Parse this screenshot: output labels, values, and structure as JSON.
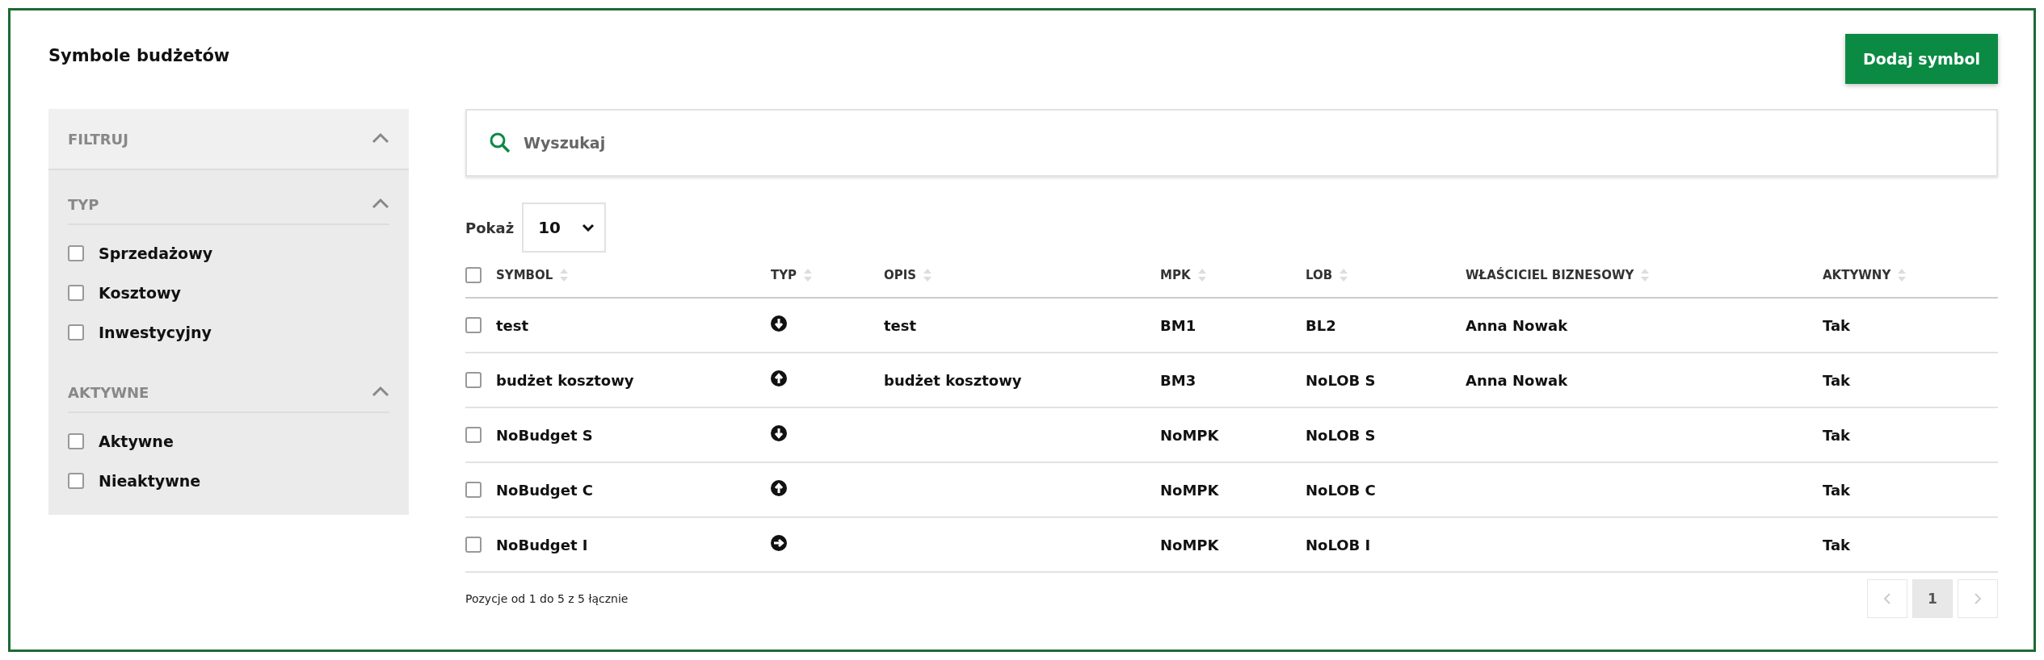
{
  "title": "Symbole budżetów",
  "add_button": "Dodaj symbol",
  "filter": {
    "title": "FILTRUJ",
    "expanded": true,
    "groups": [
      {
        "title": "TYP",
        "expanded": true,
        "options": [
          {
            "label": "Sprzedażowy",
            "checked": false
          },
          {
            "label": "Kosztowy",
            "checked": false
          },
          {
            "label": "Inwestycyjny",
            "checked": false
          }
        ]
      },
      {
        "title": "AKTYWNE",
        "expanded": true,
        "options": [
          {
            "label": "Aktywne",
            "checked": false
          },
          {
            "label": "Nieaktywne",
            "checked": false
          }
        ]
      }
    ]
  },
  "search": {
    "placeholder": "Wyszukaj"
  },
  "page_size": {
    "label": "Pokaż",
    "value": "10"
  },
  "table": {
    "select_all": false,
    "columns": [
      "SYMBOL",
      "TYP",
      "OPIS",
      "MPK",
      "LOB",
      "WŁAŚCICIEL BIZNESOWY",
      "AKTYWNY"
    ],
    "rows": [
      {
        "checked": false,
        "symbol": "test",
        "kind": "down",
        "opis": "test",
        "mpk": "BM1",
        "lob": "BL2",
        "owner": "Anna Nowak",
        "active": "Tak"
      },
      {
        "checked": false,
        "symbol": "budżet kosztowy",
        "kind": "up",
        "opis": "budżet kosztowy",
        "mpk": "BM3",
        "lob": "NoLOB S",
        "owner": "Anna Nowak",
        "active": "Tak"
      },
      {
        "checked": false,
        "symbol": "NoBudget S",
        "kind": "down",
        "mpk": "NoMPK",
        "lob": "NoLOB S",
        "active": "Tak"
      },
      {
        "checked": false,
        "symbol": "NoBudget C",
        "kind": "up",
        "mpk": "NoMPK",
        "lob": "NoLOB C",
        "active": "Tak"
      },
      {
        "checked": false,
        "symbol": "NoBudget I",
        "kind": "right",
        "mpk": "NoMPK",
        "lob": "NoLOB I",
        "active": "Tak"
      }
    ]
  },
  "footer": {
    "info": "Pozycje od 1 do 5 z 5 łącznie",
    "pages": [
      {
        "label": "1",
        "selected": true
      }
    ]
  }
}
